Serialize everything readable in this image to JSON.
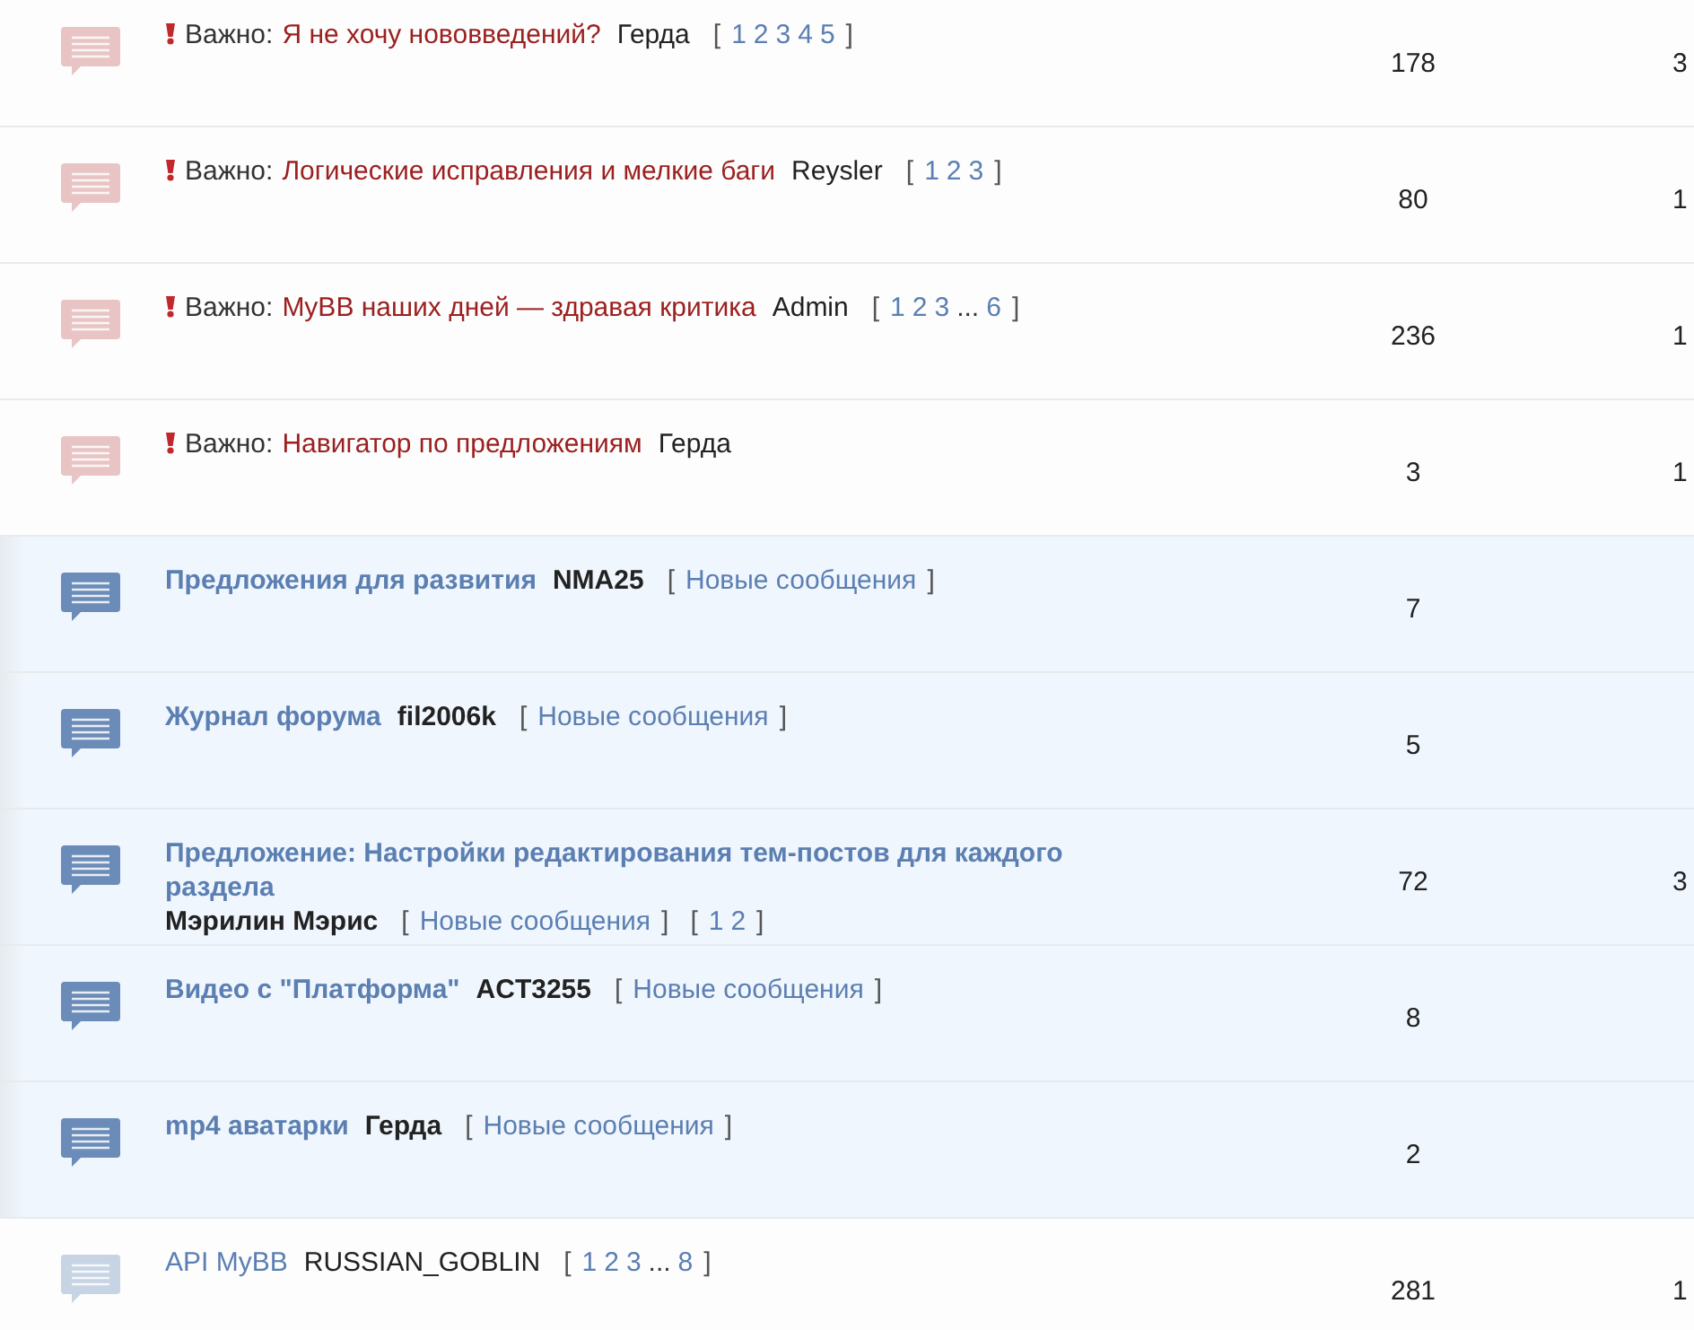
{
  "topics": [
    {
      "kind": "sticky",
      "prefix": "Важно:",
      "title": "Я не хочу нововведений?",
      "author": "Герда",
      "pages": {
        "open": "[",
        "items": [
          {
            "kind": "page",
            "label": "1"
          },
          {
            "kind": "page",
            "label": "2"
          },
          {
            "kind": "page",
            "label": "3"
          },
          {
            "kind": "page",
            "label": "4"
          },
          {
            "kind": "page",
            "label": "5"
          }
        ],
        "close": "]"
      },
      "replies": "178",
      "column_3": "3"
    },
    {
      "kind": "sticky",
      "prefix": "Важно:",
      "title": "Логические исправления и мелкие баги",
      "author": "Reysler",
      "pages": {
        "open": "[",
        "items": [
          {
            "kind": "page",
            "label": "1"
          },
          {
            "kind": "page",
            "label": "2"
          },
          {
            "kind": "page",
            "label": "3"
          }
        ],
        "close": "]"
      },
      "replies": "80",
      "column_3": "1"
    },
    {
      "kind": "sticky",
      "prefix": "Важно:",
      "title": "MyBB наших дней — здравая критика",
      "author": "Admin",
      "pages": {
        "open": "[",
        "items": [
          {
            "kind": "page",
            "label": "1"
          },
          {
            "kind": "page",
            "label": "2"
          },
          {
            "kind": "page",
            "label": "3"
          },
          {
            "kind": "ellipsis",
            "label": "..."
          },
          {
            "kind": "page",
            "label": "6"
          }
        ],
        "close": "]"
      },
      "replies": "236",
      "column_3": "1"
    },
    {
      "kind": "sticky",
      "prefix": "Важно:",
      "title": "Навигатор по предложениям",
      "author": "Герда",
      "replies": "3",
      "column_3": "1"
    },
    {
      "kind": "new",
      "title": "Предложения для развития",
      "author": "NMA25",
      "new_link": {
        "open": "[",
        "label": "Новые сообщения",
        "close": "]"
      },
      "replies": "7"
    },
    {
      "kind": "new",
      "title": "Журнал форума",
      "author": "fil2006k",
      "new_link": {
        "open": "[",
        "label": "Новые сообщения",
        "close": "]"
      },
      "replies": "5"
    },
    {
      "kind": "new",
      "title": "Предложение: Настройки редактирования тем-постов для каждого раздела",
      "author": "Мэрилин Мэрис",
      "new_link": {
        "open": "[",
        "label": "Новые сообщения",
        "close": "]"
      },
      "pages": {
        "open": "[",
        "items": [
          {
            "kind": "page",
            "label": "1"
          },
          {
            "kind": "page",
            "label": "2"
          }
        ],
        "close": "]"
      },
      "replies": "72",
      "column_3": "3"
    },
    {
      "kind": "new",
      "title": "Видео с \"Платформа\"",
      "author": "ACT3255",
      "new_link": {
        "open": "[",
        "label": "Новые сообщения",
        "close": "]"
      },
      "replies": "8"
    },
    {
      "kind": "new",
      "title": "mp4 аватарки",
      "author": "Герда",
      "new_link": {
        "open": "[",
        "label": "Новые сообщения",
        "close": "]"
      },
      "replies": "2"
    },
    {
      "kind": "normal",
      "title": "API MyBB",
      "author": "RUSSIAN_GOBLIN",
      "pages": {
        "open": "[",
        "items": [
          {
            "kind": "page",
            "label": "1"
          },
          {
            "kind": "page",
            "label": "2"
          },
          {
            "kind": "page",
            "label": "3"
          },
          {
            "kind": "ellipsis",
            "label": "..."
          },
          {
            "kind": "page",
            "label": "8"
          }
        ],
        "close": "]"
      },
      "replies": "281",
      "column_3": "1"
    }
  ]
}
